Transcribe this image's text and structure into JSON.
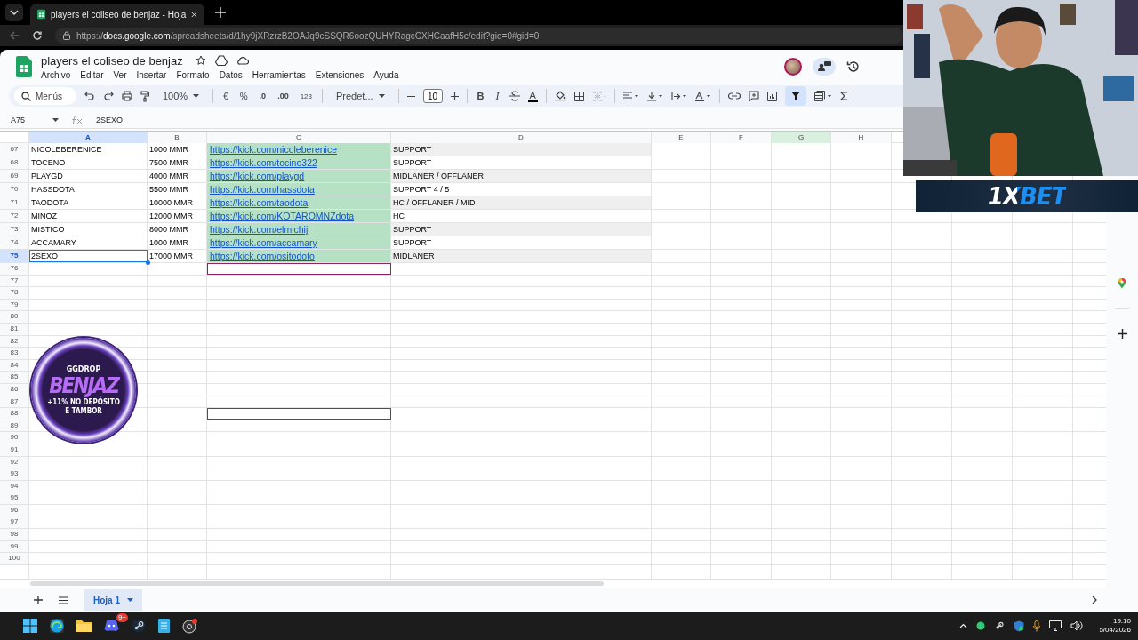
{
  "browser": {
    "tab_title": "players el coliseo de benjaz - Hoja",
    "url_scheme": "https://",
    "url_host": "docs.google.com",
    "url_path": "/spreadsheets/d/1hy9jXRzrzB2OAJq9cSSQR6oozQUHYRagcCXHCaafH5c/edit?gid=0#gid=0"
  },
  "document": {
    "title": "players el coliseo de benjaz",
    "menu": [
      "Archivo",
      "Editar",
      "Ver",
      "Insertar",
      "Formato",
      "Datos",
      "Herramientas",
      "Extensiones",
      "Ayuda"
    ]
  },
  "toolbar": {
    "search_placeholder": "Menús",
    "zoom": "100%",
    "currency": "€",
    "percent": "%",
    "decimal_decrease": ".0",
    "decimal_increase": ".00",
    "number_format": "123",
    "font": "Predet...",
    "font_size": "10",
    "bold": "B",
    "italic": "I",
    "text_color": "A",
    "filter_on": true
  },
  "formula_bar": {
    "cell_ref": "A75",
    "formula": "2SEXO"
  },
  "columns": [
    {
      "label": "A",
      "selected": true,
      "highlighted": false
    },
    {
      "label": "B",
      "selected": false,
      "highlighted": false
    },
    {
      "label": "C",
      "selected": false,
      "highlighted": false
    },
    {
      "label": "D",
      "selected": false,
      "highlighted": false
    },
    {
      "label": "E",
      "selected": false,
      "highlighted": false
    },
    {
      "label": "F",
      "selected": false,
      "highlighted": false
    },
    {
      "label": "G",
      "selected": false,
      "highlighted": true
    },
    {
      "label": "H",
      "selected": false,
      "highlighted": false
    }
  ],
  "rows": [
    {
      "number": "67",
      "name": "NICOLEBERENICE",
      "mmr": "1000 MMR",
      "link": "https://kick.com/nicoleberenice",
      "role": "SUPPORT",
      "shaded": true,
      "selected": false
    },
    {
      "number": "68",
      "name": "TOCENO",
      "mmr": "7500 MMR",
      "link": "https://kick.com/tocino322",
      "role": "SUPPORT",
      "shaded": false,
      "selected": false
    },
    {
      "number": "69",
      "name": "PLAYGD",
      "mmr": "4000 MMR",
      "link": "https://kick.com/playgd",
      "role": "MIDLANER / OFFLANER",
      "shaded": true,
      "selected": false
    },
    {
      "number": "70",
      "name": "HASSDOTA",
      "mmr": "5500 MMR",
      "link": "https://kick.com/hassdota",
      "role": "SUPPORT 4 / 5",
      "shaded": false,
      "selected": false
    },
    {
      "number": "71",
      "name": "TAODOTA",
      "mmr": "10000 MMR",
      "link": "https://kick.com/taodota",
      "role": "HC / OFFLANER / MID",
      "shaded": true,
      "selected": false
    },
    {
      "number": "72",
      "name": "MINOZ",
      "mmr": "12000 MMR",
      "link": "https://kick.com/KOTAROMNZdota",
      "role": "HC",
      "shaded": false,
      "selected": false
    },
    {
      "number": "73",
      "name": "MISTICO",
      "mmr": "8000 MMR",
      "link": "https://kick.com/elmichij",
      "role": "SUPPORT",
      "shaded": true,
      "selected": false
    },
    {
      "number": "74",
      "name": "ACCAMARY",
      "mmr": "1000 MMR",
      "link": "https://kick.com/accamary",
      "role": "SUPPORT",
      "shaded": false,
      "selected": false
    },
    {
      "number": "75",
      "name": "2SEXO",
      "mmr": "17000 MMR",
      "link": "https://kick.com/ositodoto",
      "role": "MIDLANER",
      "shaded": true,
      "selected": true
    }
  ],
  "empty_rows": [
    {
      "number": "76",
      "color": "#8e2466"
    },
    {
      "number": "77"
    },
    {
      "number": "78"
    },
    {
      "number": "79"
    },
    {
      "number": "80"
    },
    {
      "number": "81"
    },
    {
      "number": "82"
    },
    {
      "number": "83"
    },
    {
      "number": "84"
    },
    {
      "number": "85"
    },
    {
      "number": "86"
    },
    {
      "number": "87"
    },
    {
      "number": "88",
      "color": "#1e6e3c"
    },
    {
      "number": "89"
    },
    {
      "number": "90"
    },
    {
      "number": "91"
    },
    {
      "number": "92"
    },
    {
      "number": "93"
    },
    {
      "number": "94"
    },
    {
      "number": "95"
    },
    {
      "number": "96"
    },
    {
      "number": "97"
    },
    {
      "number": "98"
    },
    {
      "number": "99"
    },
    {
      "number": "100"
    }
  ],
  "sheet_tabs": [
    {
      "label": "Hoja 1",
      "selected": true
    }
  ],
  "overlays": {
    "badge": {
      "brand": "GGDROP",
      "name": "BENJAZ",
      "lines": [
        "+11% NO DEPÓSITO",
        "E TAMBOR"
      ]
    },
    "banner": "1XBET"
  },
  "taskbar": {
    "discord_badge": "9+",
    "time": "19:10",
    "date": "5/04/2026"
  }
}
